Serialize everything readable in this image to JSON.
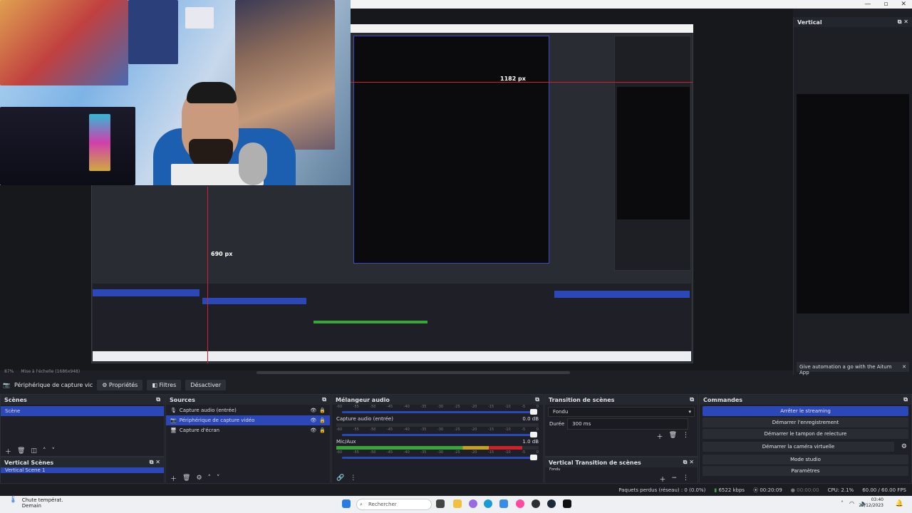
{
  "window": {
    "minimize": "—",
    "maximize": "▫",
    "close": "✕"
  },
  "preview": {
    "label_horizontal_px": "1182 px",
    "label_vertical_px": "690 px",
    "zoom": "87%",
    "scale_text": "Mise à l'échelle (1686x948)"
  },
  "vertical_panel": {
    "title": "Vertical",
    "notice": "Give automation a go with the Aitum App"
  },
  "source_toolbar": {
    "selected_source": "Périphérique de capture vic",
    "properties": "Propriétés",
    "filters": "Filtres",
    "deactivate": "Désactiver"
  },
  "scenes": {
    "title": "Scènes",
    "items": [
      "Scène"
    ]
  },
  "vertical_scenes": {
    "title": "Vertical Scènes",
    "items": [
      "Vertical Scene 1"
    ]
  },
  "sources": {
    "title": "Sources",
    "items": [
      {
        "label": "Capture audio (entrée)",
        "icon": "microphone-icon"
      },
      {
        "label": "Périphérique de capture vidéo",
        "icon": "camera-icon"
      },
      {
        "label": "Capture d'écran",
        "icon": "monitor-icon"
      }
    ]
  },
  "mixer": {
    "title": "Mélangeur audio",
    "ticks": [
      "-60",
      "-55",
      "-50",
      "-45",
      "-40",
      "-35",
      "-30",
      "-25",
      "-20",
      "-15",
      "-10",
      "-5",
      "0"
    ],
    "channels": [
      {
        "name": "",
        "db": "",
        "level": 0.0
      },
      {
        "name": "Capture audio (entrée)",
        "db": "0.0 dB",
        "level": 0.0
      },
      {
        "name": "Mic/Aux",
        "db": "1.0 dB",
        "level": 0.92
      }
    ]
  },
  "transition": {
    "title": "Transition de scènes",
    "type": "Fondu",
    "duration_label": "Durée",
    "duration_value": "300 ms"
  },
  "vertical_transition": {
    "title": "Vertical Transition de scènes",
    "type": "Fondu"
  },
  "commands": {
    "title": "Commandes",
    "buttons": [
      "Arrêter le streaming",
      "Démarrer l'enregistrement",
      "Démarrer le tampon de relecture",
      "Démarrer la caméra virtuelle",
      "Mode studio",
      "Paramètres"
    ]
  },
  "status": {
    "dropped": "Paquets perdus (réseau) : 0 (0.0%)",
    "bitrate": "6522 kbps",
    "stream_time": "00:20:09",
    "rec_time": "00:00:00",
    "cpu": "CPU: 2.1%",
    "fps": "60.00 / 60.00 FPS"
  },
  "taskbar": {
    "weather_title": "Chute températ.",
    "weather_sub": "Demain",
    "search": "Rechercher",
    "time": "03:40",
    "date": "29/12/2023"
  },
  "colors": {
    "accent": "#2c47b8",
    "danger": "#d0202a",
    "meter_green": "#3ba53b",
    "meter_yellow": "#c8a020"
  }
}
